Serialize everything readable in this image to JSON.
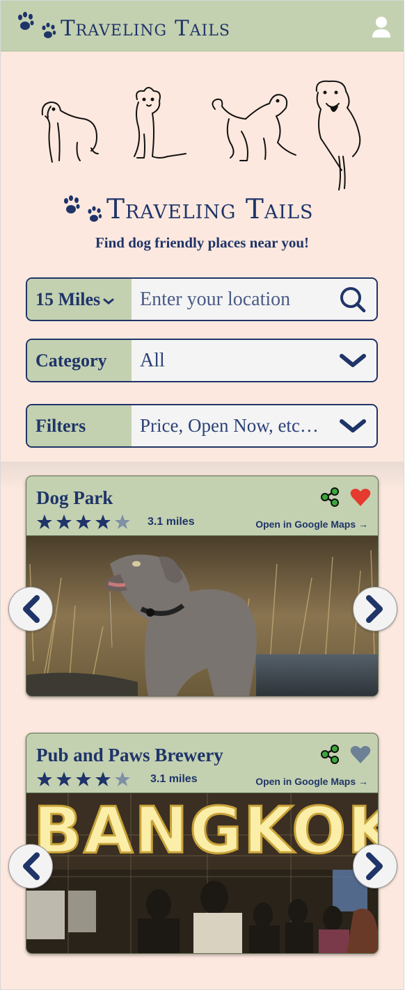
{
  "header": {
    "brand": "Traveling Tails",
    "user_icon": "user-icon"
  },
  "hero": {
    "brand": "Traveling Tails",
    "tagline": "Find dog friendly places near you!"
  },
  "search": {
    "distance_label": "15 Miles",
    "location_placeholder": "Enter your location",
    "category_label": "Category",
    "category_value": "All",
    "filters_label": "Filters",
    "filters_value": "Price, Open Now, etc…"
  },
  "colors": {
    "navy": "#1f3468",
    "sage": "#c3d1b1",
    "peach": "#fce8de",
    "heart_red": "#e53a2e",
    "share_green": "#3aa83a"
  },
  "results": [
    {
      "title": "Dog Park",
      "rating": 4,
      "max_rating": 5,
      "distance": "3.1 miles",
      "maps_link": "Open in Google Maps",
      "favorited": true
    },
    {
      "title": "Pub and Paws Brewery",
      "rating": 4,
      "max_rating": 5,
      "distance": "3.1 miles",
      "maps_link": "Open in Google Maps",
      "favorited": false
    }
  ],
  "photo2_sign_text": "BANGKOK"
}
